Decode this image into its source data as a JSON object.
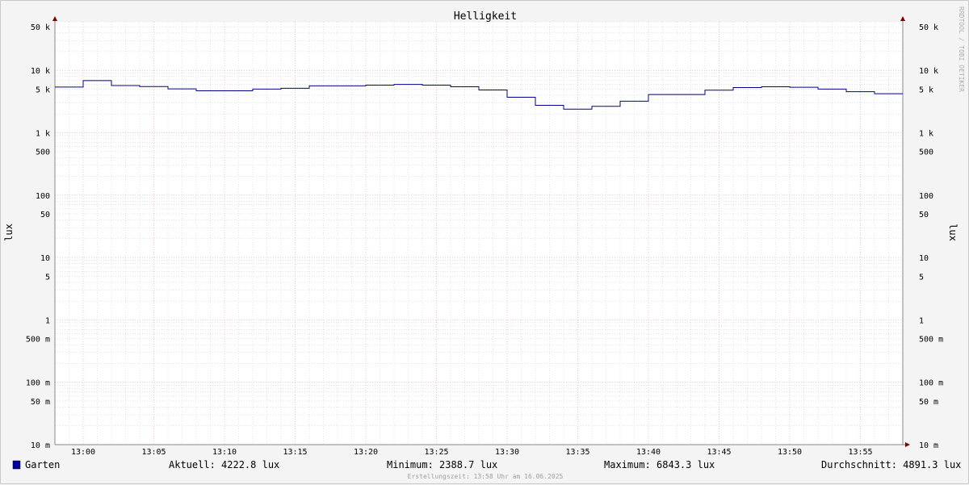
{
  "chart_data": {
    "type": "line",
    "title": "Helligkeit",
    "ylabel": "lux",
    "ylabel_right": "lux",
    "y_scale": "log",
    "ylim": [
      0.01,
      60000
    ],
    "y_tick_labels": [
      {
        "v": 50000,
        "label": "50 k"
      },
      {
        "v": 10000,
        "label": "10 k"
      },
      {
        "v": 5000,
        "label": "5 k"
      },
      {
        "v": 1000,
        "label": "1 k"
      },
      {
        "v": 500,
        "label": "500"
      },
      {
        "v": 100,
        "label": "100"
      },
      {
        "v": 50,
        "label": "50"
      },
      {
        "v": 10,
        "label": "10"
      },
      {
        "v": 5,
        "label": "5"
      },
      {
        "v": 1,
        "label": "1"
      },
      {
        "v": 0.5,
        "label": "500 m"
      },
      {
        "v": 0.1,
        "label": "100 m"
      },
      {
        "v": 0.05,
        "label": "50 m"
      },
      {
        "v": 0.01,
        "label": "10 m"
      }
    ],
    "xlim": [
      "12:58",
      "13:58"
    ],
    "x_tick_labels": [
      "13:00",
      "13:05",
      "13:10",
      "13:15",
      "13:20",
      "13:25",
      "13:30",
      "13:35",
      "13:40",
      "13:45",
      "13:50",
      "13:55"
    ],
    "grid": true,
    "series": [
      {
        "name": "Garten",
        "color": "#00008b",
        "x": [
          "12:58",
          "13:00",
          "13:02",
          "13:04",
          "13:06",
          "13:08",
          "13:10",
          "13:12",
          "13:14",
          "13:16",
          "13:18",
          "13:20",
          "13:22",
          "13:24",
          "13:26",
          "13:28",
          "13:30",
          "13:32",
          "13:34",
          "13:36",
          "13:38",
          "13:40",
          "13:42",
          "13:44",
          "13:46",
          "13:48",
          "13:50",
          "13:52",
          "13:54",
          "13:56",
          "13:58"
        ],
        "y": [
          5400,
          6843.3,
          5700,
          5500,
          5050,
          4700,
          4700,
          5000,
          5150,
          5650,
          5650,
          5800,
          5950,
          5800,
          5450,
          4850,
          3700,
          2750,
          2388.7,
          2650,
          3200,
          4100,
          4100,
          4800,
          5300,
          5450,
          5350,
          5000,
          4550,
          4222.8,
          4222.8
        ]
      }
    ],
    "legend_position": "bottom"
  },
  "legend": {
    "series_name": "Garten",
    "aktuell": "Aktuell: 4222.8 lux",
    "minimum": "Minimum: 2388.7 lux",
    "maximum": "Maximum: 6843.3 lux",
    "durchschnitt": "Durchschnitt: 4891.3 lux"
  },
  "footer": "Erstellungszeit: 13:58 Uhr am 16.06.2025",
  "watermark": "RRDTOOL / TOBI OETIKER",
  "colors": {
    "line": "#00008b",
    "legend_swatch": "#0000a0",
    "major_grid": "#e8a0a0",
    "minor_grid": "#c8c8c8",
    "plot_bg": "#ffffff",
    "canvas_bg": "#f4f4f4",
    "arrow": "#800000"
  }
}
